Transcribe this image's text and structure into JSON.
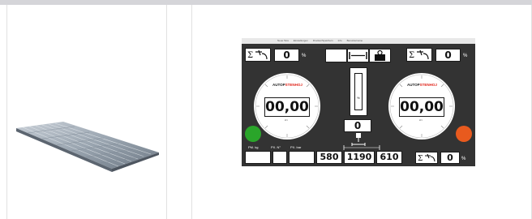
{
  "colors": {
    "top_bar": "#d5d5d9",
    "screen_bg": "#333333",
    "status_green": "#2aa52a",
    "status_orange": "#e85a1e",
    "brand_red": "#e0251b"
  },
  "software": {
    "menu": [
      "Neue Tara",
      "Einstellungen",
      "Drucker/Speichern",
      "Info",
      "Benutzername"
    ],
    "left_sum_value": "0",
    "right_sum_value": "0",
    "sum_unit": "%",
    "left_display": "00,00",
    "right_display": "00,00",
    "left_display_unit": "kN",
    "right_display_unit": "kN",
    "brand_part1": "AUTOP",
    "brand_part2": "STENHOJ",
    "center_value": "0",
    "center_unit": "%",
    "bottom_labels": [
      "PM. kg",
      "PX. N°",
      "PX. bar"
    ],
    "dimensions": [
      "580",
      "1190",
      "610"
    ],
    "bottom_right_value": "0",
    "bottom_right_unit": "%"
  },
  "icons": {
    "sum_icon": "sum-pressure-icon",
    "weight_icon": "weight-icon",
    "width_icon": "width-arrows-icon",
    "scale_icon": "scale-icon"
  }
}
